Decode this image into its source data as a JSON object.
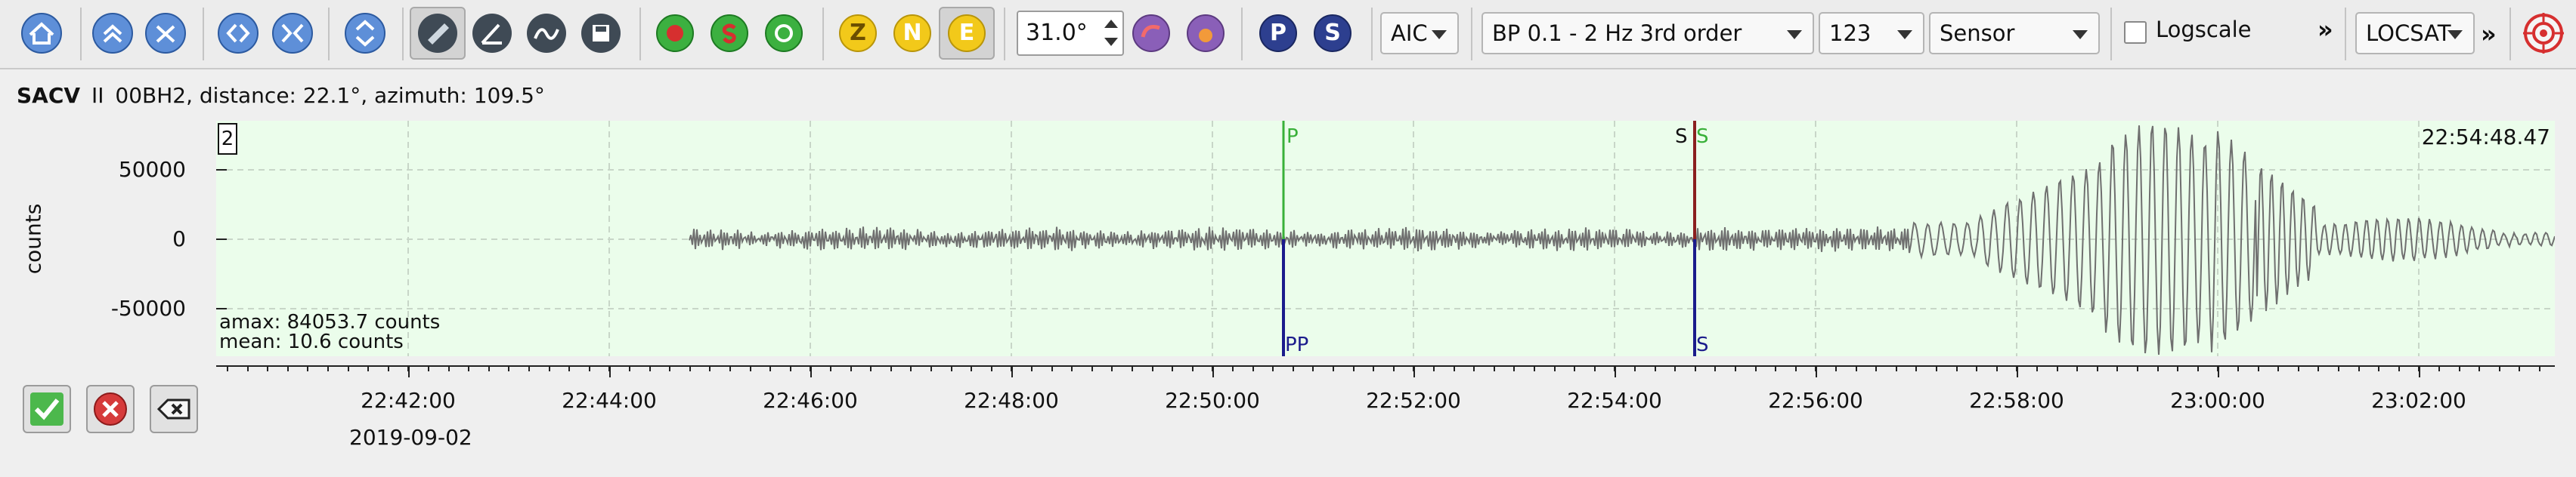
{
  "toolbar": {
    "magnitude_value": "31.0°",
    "method_select": "AIC",
    "filter_select": "BP 0.1 - 2 Hz  3rd order",
    "components_select": "123",
    "unit_select": "Sensor",
    "logscale_label": "Logscale",
    "logscale_checked": false,
    "more_label": "»",
    "locator_select": "LOCSAT",
    "more2_label": "»",
    "comp_z": "Z",
    "comp_n": "N",
    "comp_e": "E",
    "pick_p": "P",
    "pick_s": "S"
  },
  "trace": {
    "station": "SACV",
    "separator": "II",
    "channel_info": "00BH2, distance: 22.1°, azimuth: 109.5°",
    "index_badge": "2",
    "time_stamp": "22:54:48.47",
    "amax": "amax: 84053.7 counts",
    "mean": "mean: 10.6 counts",
    "y_axis_label": "counts",
    "y_ticks": [
      "50000",
      "0",
      "-50000"
    ],
    "x_ticks": [
      "22:42:00",
      "22:44:00",
      "22:46:00",
      "22:48:00",
      "22:50:00",
      "22:52:00",
      "22:54:00",
      "22:56:00",
      "22:58:00",
      "23:00:00",
      "23:02:00"
    ],
    "date": "2019-09-02",
    "picks": {
      "p_top": "P",
      "p_bottom": "PP",
      "s_top_left": "S",
      "s_top_right": "S",
      "s_bottom": "S"
    }
  },
  "colors": {
    "plot_background": "#ebfdeb",
    "trace": "#6f6f6f",
    "p_pick": "#38b038",
    "s_pick": "#8b1f1f",
    "theoretical_pick": "#1b1b8c"
  }
}
